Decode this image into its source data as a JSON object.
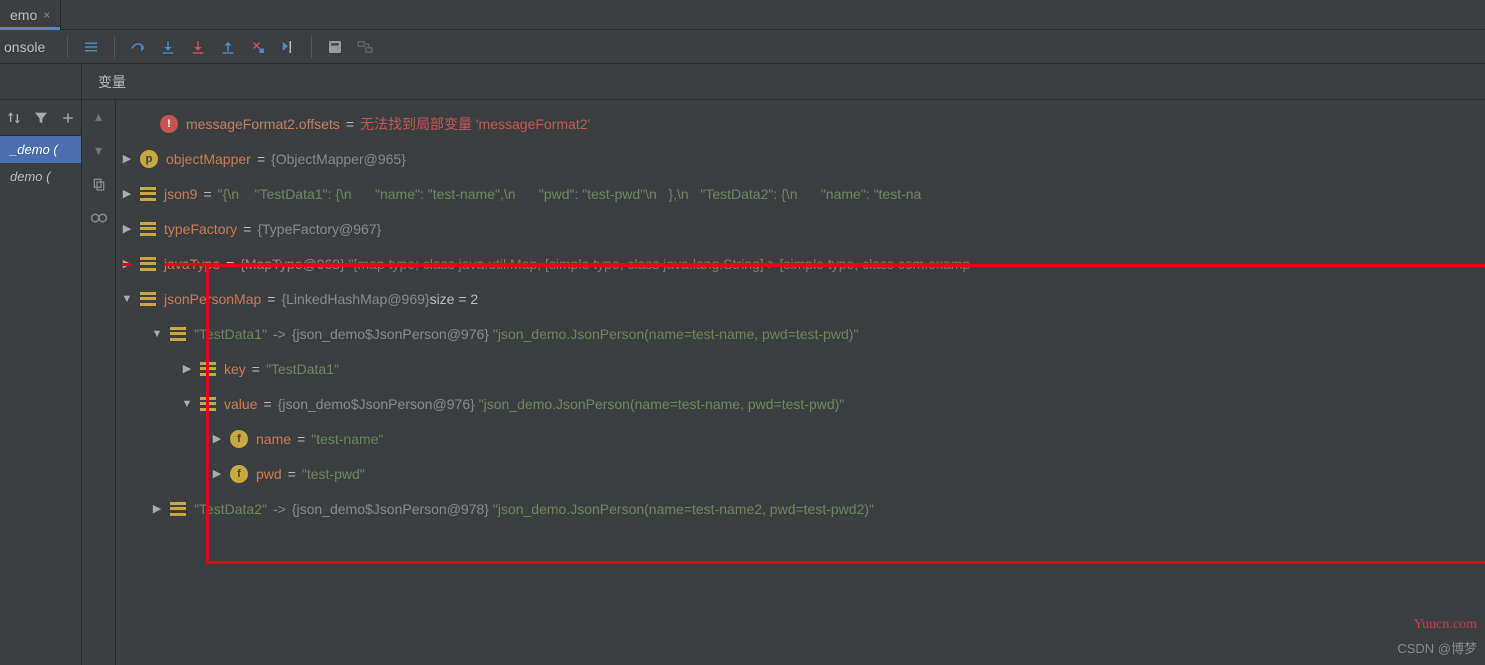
{
  "tab": {
    "title": "emo",
    "close": "×"
  },
  "toolbar": {
    "console_label": "onsole"
  },
  "left": {
    "thread_sel": "_demo (",
    "thread_other": "demo ("
  },
  "vars_header": "变量",
  "rows": {
    "r1_name": "messageFormat2.offsets",
    "r1_err": "无法找到局部变量 'messageFormat2'",
    "r2_name": "objectMapper",
    "r2_obj": "{ObjectMapper@965}",
    "r3_name": "json9",
    "r3_a": "\"{\\n",
    "r3_b": "\"TestData1\": {\\n",
    "r3_c": "\"name\": \"test-name\",\\n",
    "r3_d": "\"pwd\": \"test-pwd\"\\n",
    "r3_e": "},\\n",
    "r3_f": "\"TestData2\": {\\n",
    "r3_g": "\"name\": \"test-na",
    "r4_name": "typeFactory",
    "r4_obj": "{TypeFactory@967}",
    "r5_name": "javaType",
    "r5_obj": "{MapType@968}",
    "r5_str": "\"[map type; class java.util.Map, [simple type, class java.lang.String]  > [simple type, class com.examp",
    "r6_name": "jsonPersonMap",
    "r6_obj": "{LinkedHashMap@969}",
    "r6_size": " size = 2",
    "r7_key": "\"TestData1\"",
    "r7_obj": "{json_demo$JsonPerson@976}",
    "r7_str": "\"json_demo.JsonPerson(name=test-name, pwd=test-pwd)\"",
    "r8_name": "key",
    "r8_val": "\"TestData1\"",
    "r9_name": "value",
    "r9_obj": "{json_demo$JsonPerson@976}",
    "r9_str": "\"json_demo.JsonPerson(name=test-name, pwd=test-pwd)\"",
    "r10_name": "name",
    "r10_val": "\"test-name\"",
    "r11_name": "pwd",
    "r11_val": "\"test-pwd\"",
    "r12_key": "\"TestData2\"",
    "r12_obj": "{json_demo$JsonPerson@978}",
    "r12_str": "\"json_demo.JsonPerson(name=test-name2, pwd=test-pwd2)\""
  },
  "watermark1": "Yuucn.com",
  "watermark2": "CSDN @博梦"
}
